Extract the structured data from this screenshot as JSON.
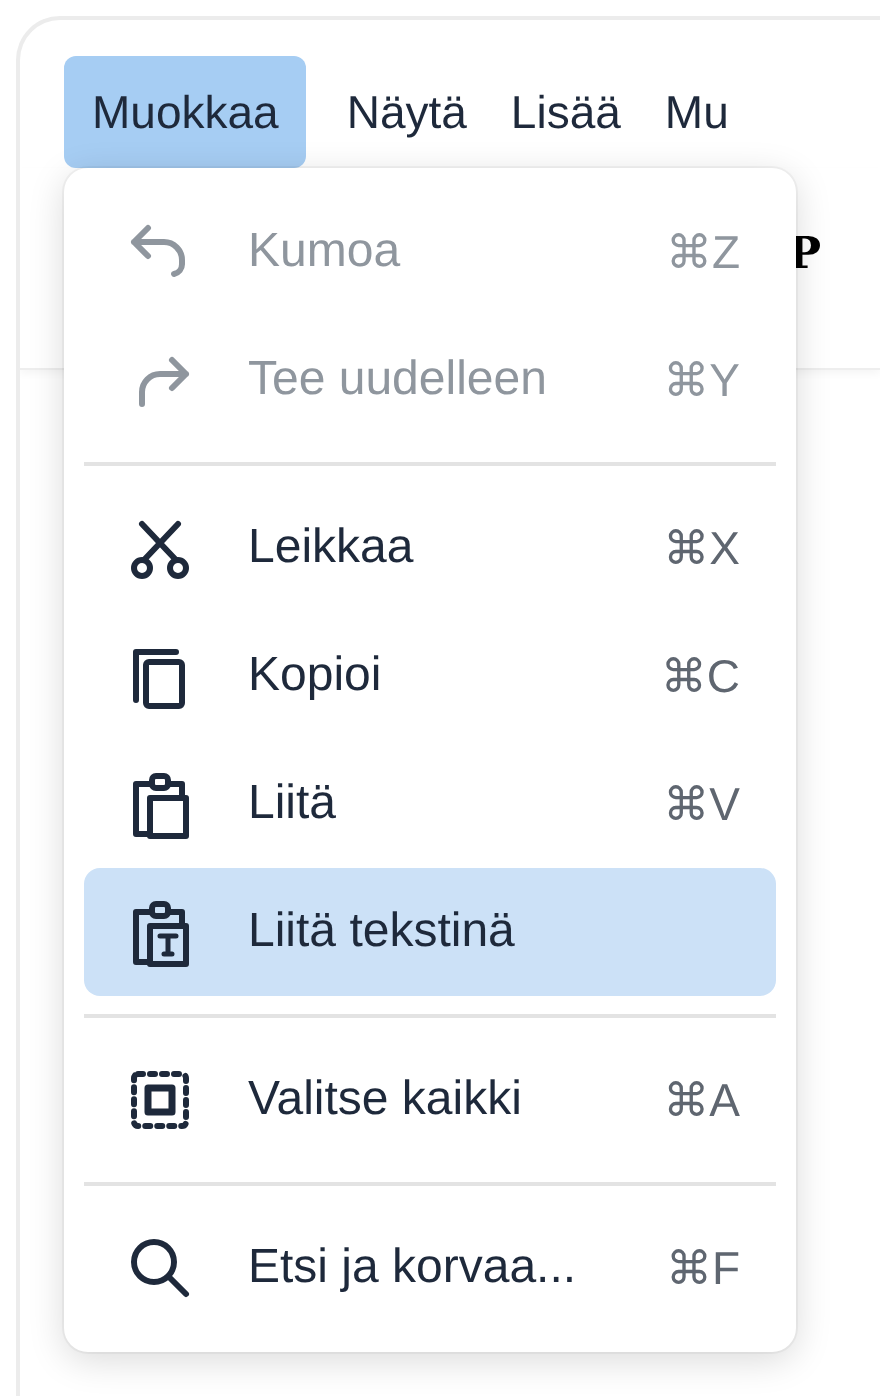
{
  "menubar": [
    {
      "label": "Muokkaa",
      "selected": true
    },
    {
      "label": "Näytä",
      "selected": false
    },
    {
      "label": "Lisää",
      "selected": false
    },
    {
      "label": "Mu",
      "selected": false
    }
  ],
  "toolbar": {
    "partial_text": "P"
  },
  "menu": [
    {
      "kind": "item",
      "label": "Kumoa",
      "shortcut": "⌘Z",
      "disabled": true,
      "selected": false
    },
    {
      "kind": "item",
      "label": "Tee uudelleen",
      "shortcut": "⌘Y",
      "disabled": true,
      "selected": false
    },
    {
      "kind": "separator"
    },
    {
      "kind": "item",
      "label": "Leikkaa",
      "shortcut": "⌘X",
      "disabled": false,
      "selected": false
    },
    {
      "kind": "item",
      "label": "Kopioi",
      "shortcut": "⌘C",
      "disabled": false,
      "selected": false
    },
    {
      "kind": "item",
      "label": "Liitä",
      "shortcut": "⌘V",
      "disabled": false,
      "selected": false
    },
    {
      "kind": "item",
      "label": "Liitä tekstinä",
      "disabled": false,
      "selected": true
    },
    {
      "kind": "separator"
    },
    {
      "kind": "item",
      "label": "Valitse kaikki",
      "shortcut": "⌘A",
      "disabled": false,
      "selected": false
    },
    {
      "kind": "separator"
    },
    {
      "kind": "item",
      "label": "Etsi ja korvaa...",
      "shortcut": "⌘F",
      "disabled": false,
      "selected": false
    }
  ]
}
